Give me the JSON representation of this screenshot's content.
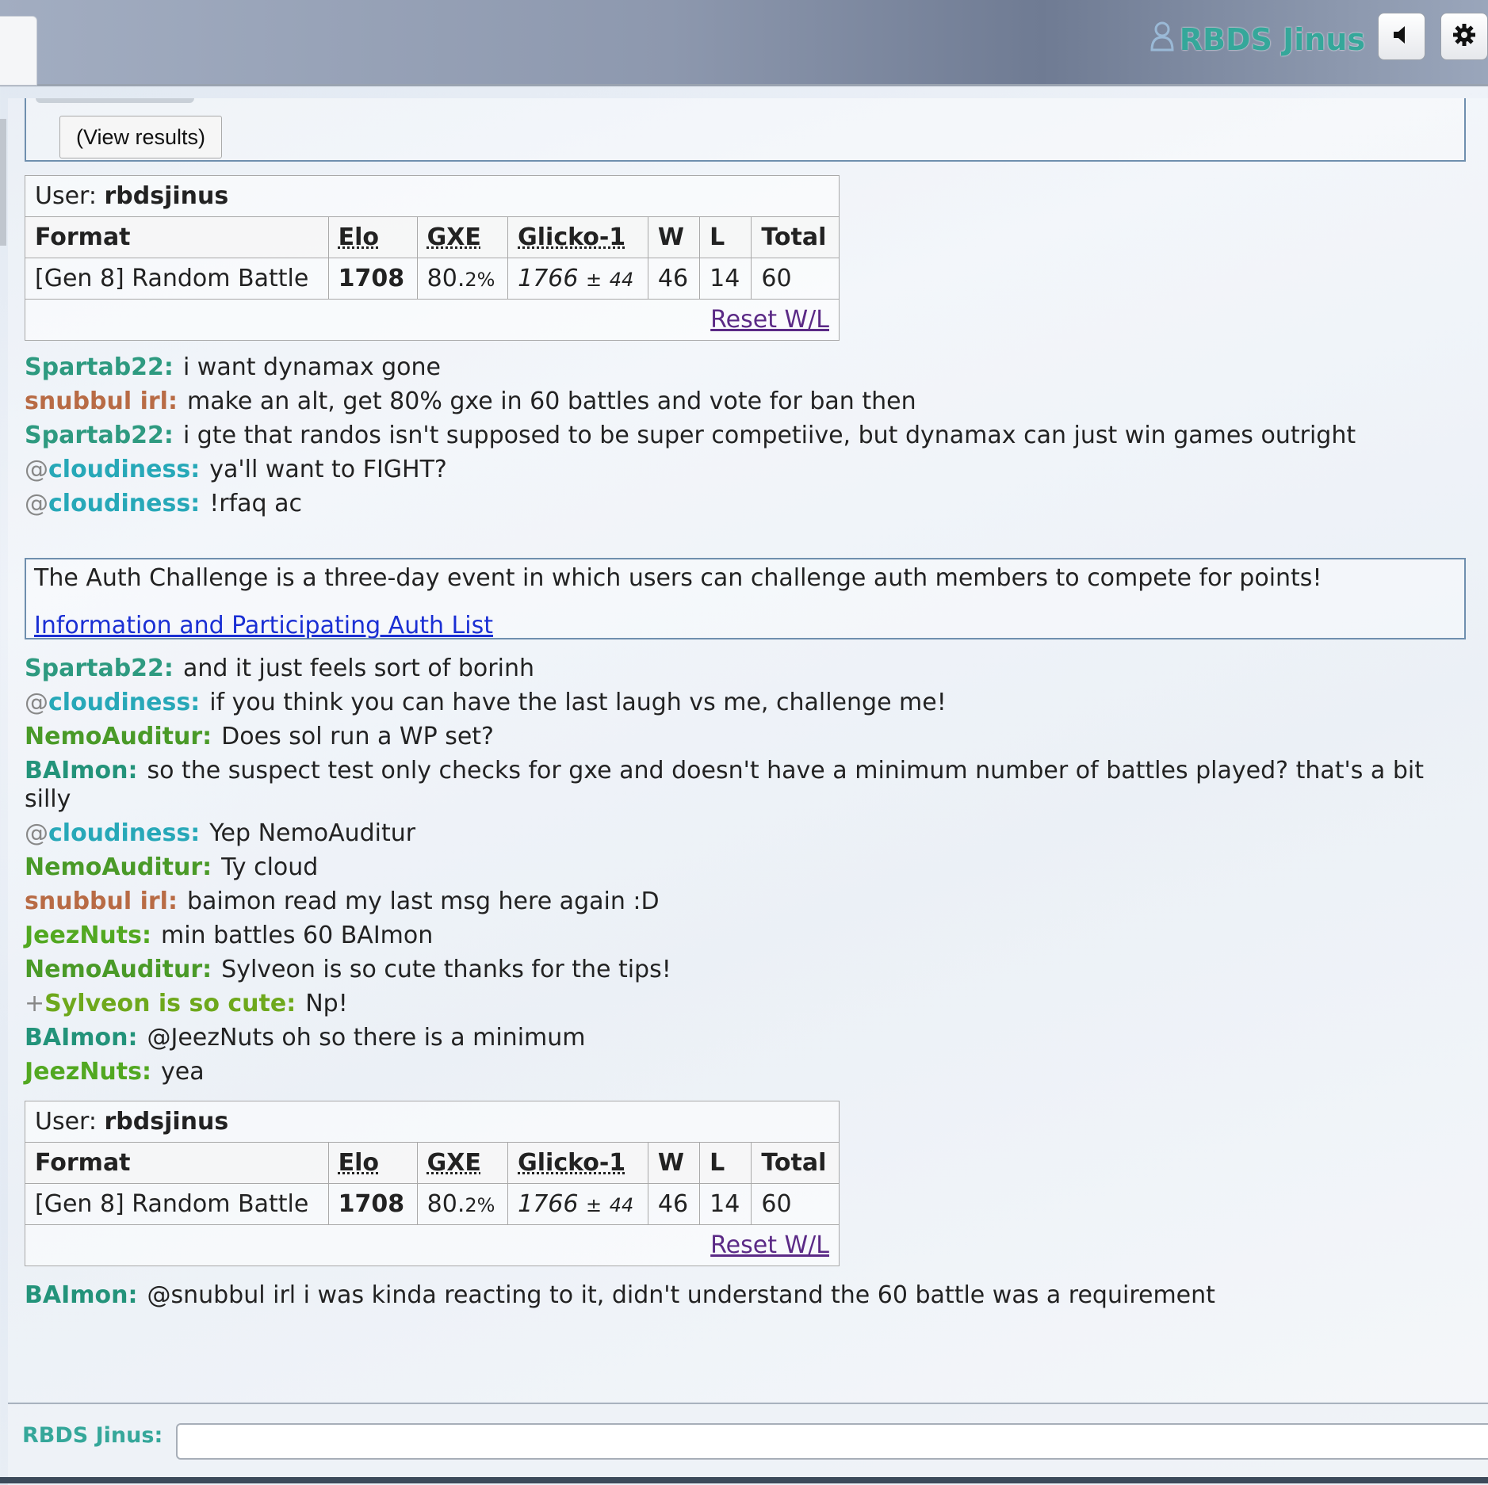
{
  "header": {
    "username": "RBDS Jinus",
    "user_icon": "user-icon",
    "sound_icon": "speaker-icon",
    "settings_icon": "gear-icon"
  },
  "poll": {
    "view_results_label": "(View results)"
  },
  "rank_tables": [
    {
      "user_label": "User:",
      "user": "rbdsjinus",
      "columns": [
        "Format",
        "Elo",
        "GXE",
        "Glicko-1",
        "W",
        "L",
        "Total"
      ],
      "row": {
        "format": "[Gen 8] Random Battle",
        "elo": "1708",
        "gxe_main": "80.",
        "gxe_decimal": "2%",
        "glicko": "1766",
        "glicko_pm": "±",
        "glicko_dev": "44",
        "w": "46",
        "l": "14",
        "total": "60"
      },
      "reset_label": "Reset W/L"
    },
    {
      "user_label": "User:",
      "user": "rbdsjinus",
      "columns": [
        "Format",
        "Elo",
        "GXE",
        "Glicko-1",
        "W",
        "L",
        "Total"
      ],
      "row": {
        "format": "[Gen 8] Random Battle",
        "elo": "1708",
        "gxe_main": "80.",
        "gxe_decimal": "2%",
        "glicko": "1766",
        "glicko_pm": "±",
        "glicko_dev": "44",
        "w": "46",
        "l": "14",
        "total": "60"
      },
      "reset_label": "Reset W/L"
    }
  ],
  "messages": [
    {
      "symbol": "",
      "user": "Spartab22:",
      "text": "i want dynamax gone"
    },
    {
      "symbol": "",
      "user": "snubbul irl:",
      "text": "make an alt, get 80% gxe in 60 battles and vote for ban then"
    },
    {
      "symbol": "",
      "user": "Spartab22:",
      "text": "i gte that randos isn't supposed to be super competiive, but dynamax can just win games outright"
    },
    {
      "symbol": "@",
      "user": "cloudiness:",
      "text": "ya'll want to FIGHT?"
    },
    {
      "symbol": "@",
      "user": "cloudiness:",
      "text": "!rfaq ac"
    },
    {
      "symbol": "",
      "user": "Spartab22:",
      "text": "and it just feels sort of borinh"
    },
    {
      "symbol": "@",
      "user": "cloudiness:",
      "text": "if you think you can have the last laugh vs me, challenge me!"
    },
    {
      "symbol": "",
      "user": "NemoAuditur:",
      "text": "Does sol run a WP set?"
    },
    {
      "symbol": "",
      "user": "BAImon:",
      "text": "so the suspect test only checks for gxe and doesn't have a minimum number of battles played? that's a bit silly"
    },
    {
      "symbol": "@",
      "user": "cloudiness:",
      "text": "Yep NemoAuditur"
    },
    {
      "symbol": "",
      "user": "NemoAuditur:",
      "text": "Ty cloud"
    },
    {
      "symbol": "",
      "user": "snubbul irl:",
      "text": "baimon read my last msg here again :D"
    },
    {
      "symbol": "",
      "user": "JeezNuts:",
      "text": "min battles 60 BAImon"
    },
    {
      "symbol": "",
      "user": "NemoAuditur:",
      "text": "Sylveon is so cute thanks for the tips!"
    },
    {
      "symbol": "+",
      "user": "Sylveon is so cute:",
      "text": "Np!"
    },
    {
      "symbol": "",
      "user": "BAImon:",
      "text": "@JeezNuts oh so there is a minimum"
    },
    {
      "symbol": "",
      "user": "JeezNuts:",
      "text": "yea"
    },
    {
      "symbol": "",
      "user": "BAImon:",
      "text": "@snubbul irl i was kinda reacting to it, didn't understand the 60 battle was a requirement"
    }
  ],
  "infobox": {
    "text": "The Auth Challenge is a three-day event in which users can challenge auth members to compete for points!",
    "link": "Information and Participating Auth List"
  },
  "input": {
    "label": "RBDS Jinus:",
    "value": ""
  },
  "colors": {
    "spartab": "#2e9a80",
    "snubbul": "#b86b45",
    "cloudiness": "#27a8b8",
    "nemo": "#4a9a28",
    "baimon": "#23937a",
    "jeez": "#52a821",
    "sylveon": "#6ea81c",
    "self": "#35a79a"
  }
}
